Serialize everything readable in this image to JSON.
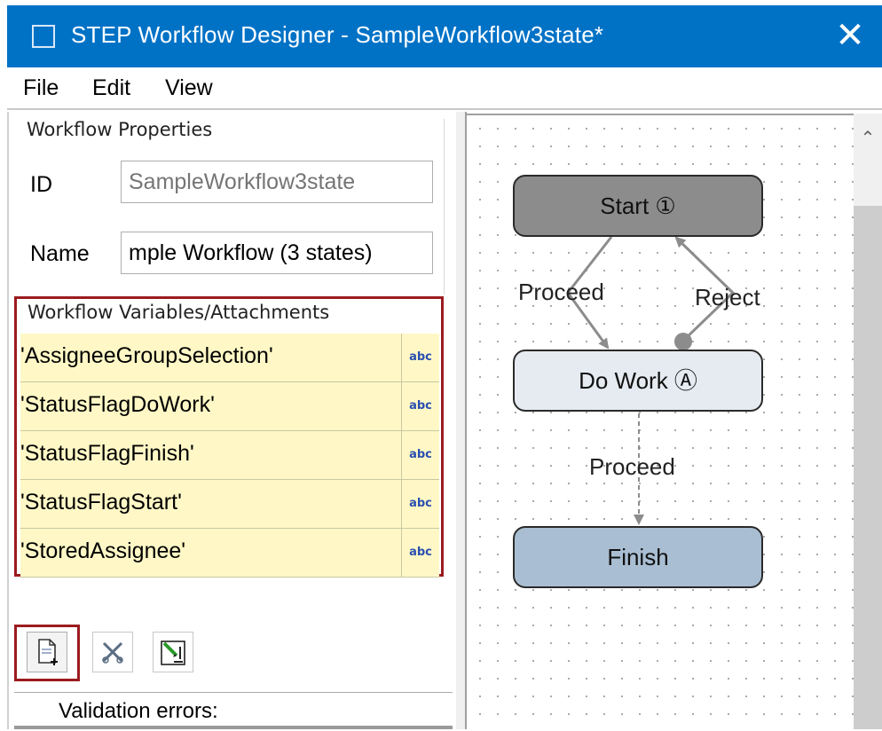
{
  "window": {
    "title": "STEP Workflow Designer - SampleWorkflow3state*",
    "close_glyph": "✕"
  },
  "menu": {
    "items": [
      "File",
      "Edit",
      "View"
    ]
  },
  "workflow_properties": {
    "section_label": "Workflow Properties",
    "id_label": "ID",
    "id_placeholder": "SampleWorkflow3state",
    "name_label": "Name",
    "name_value": "mple Workflow (3 states)"
  },
  "variables": {
    "section_label": "Workflow Variables/Attachments",
    "type_glyph": "abc",
    "items": [
      {
        "name": "'AssigneeGroupSelection'"
      },
      {
        "name": "'StatusFlagDoWork'"
      },
      {
        "name": "'StatusFlagFinish'"
      },
      {
        "name": "'StatusFlagStart'"
      },
      {
        "name": "'StoredAssignee'"
      }
    ]
  },
  "toolbar": {
    "icons": [
      "new-variable-icon",
      "delete-icon",
      "edit-variable-icon"
    ]
  },
  "validation": {
    "label": "Validation errors:"
  },
  "diagram": {
    "nodes": [
      {
        "id": "start",
        "label": "Start ①",
        "color": "#8c8c8c"
      },
      {
        "id": "dowork",
        "label": "Do Work Ⓐ",
        "color": "#e6ebf1"
      },
      {
        "id": "finish",
        "label": "Finish",
        "color": "#a9bed2"
      }
    ],
    "edges": [
      {
        "from": "start",
        "to": "dowork",
        "label": "Proceed"
      },
      {
        "from": "dowork",
        "to": "start",
        "label": "Reject"
      },
      {
        "from": "dowork",
        "to": "finish",
        "label": "Proceed"
      }
    ]
  },
  "colors": {
    "titlebar": "#0072c6",
    "highlight": "#9b1b1f",
    "variable_row": "#fff8c6"
  }
}
